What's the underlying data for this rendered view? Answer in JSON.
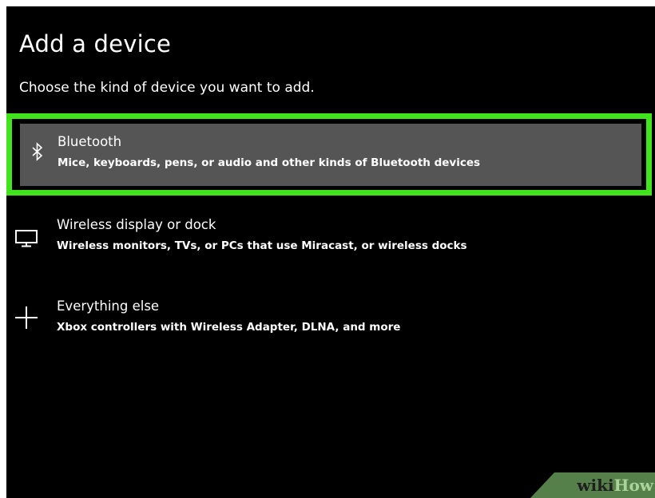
{
  "dialog": {
    "title": "Add a device",
    "subtitle": "Choose the kind of device you want to add."
  },
  "options": [
    {
      "name": "Bluetooth",
      "description": "Mice, keyboards, pens, or audio and other kinds of Bluetooth devices",
      "icon": "bluetooth-icon",
      "selected": true
    },
    {
      "name": "Wireless display or dock",
      "description": "Wireless monitors, TVs, or PCs that use Miracast, or wireless docks",
      "icon": "monitor-icon",
      "selected": false
    },
    {
      "name": "Everything else",
      "description": "Xbox controllers with Wireless Adapter, DLNA, and more",
      "icon": "plus-icon",
      "selected": false
    }
  ],
  "watermark": {
    "part1": "wiki",
    "part2": "How"
  },
  "colors": {
    "background": "#000000",
    "highlight_border": "#41e31c",
    "selected_fill": "#555555",
    "text": "#ffffff",
    "watermark_bg": "#56804a"
  }
}
